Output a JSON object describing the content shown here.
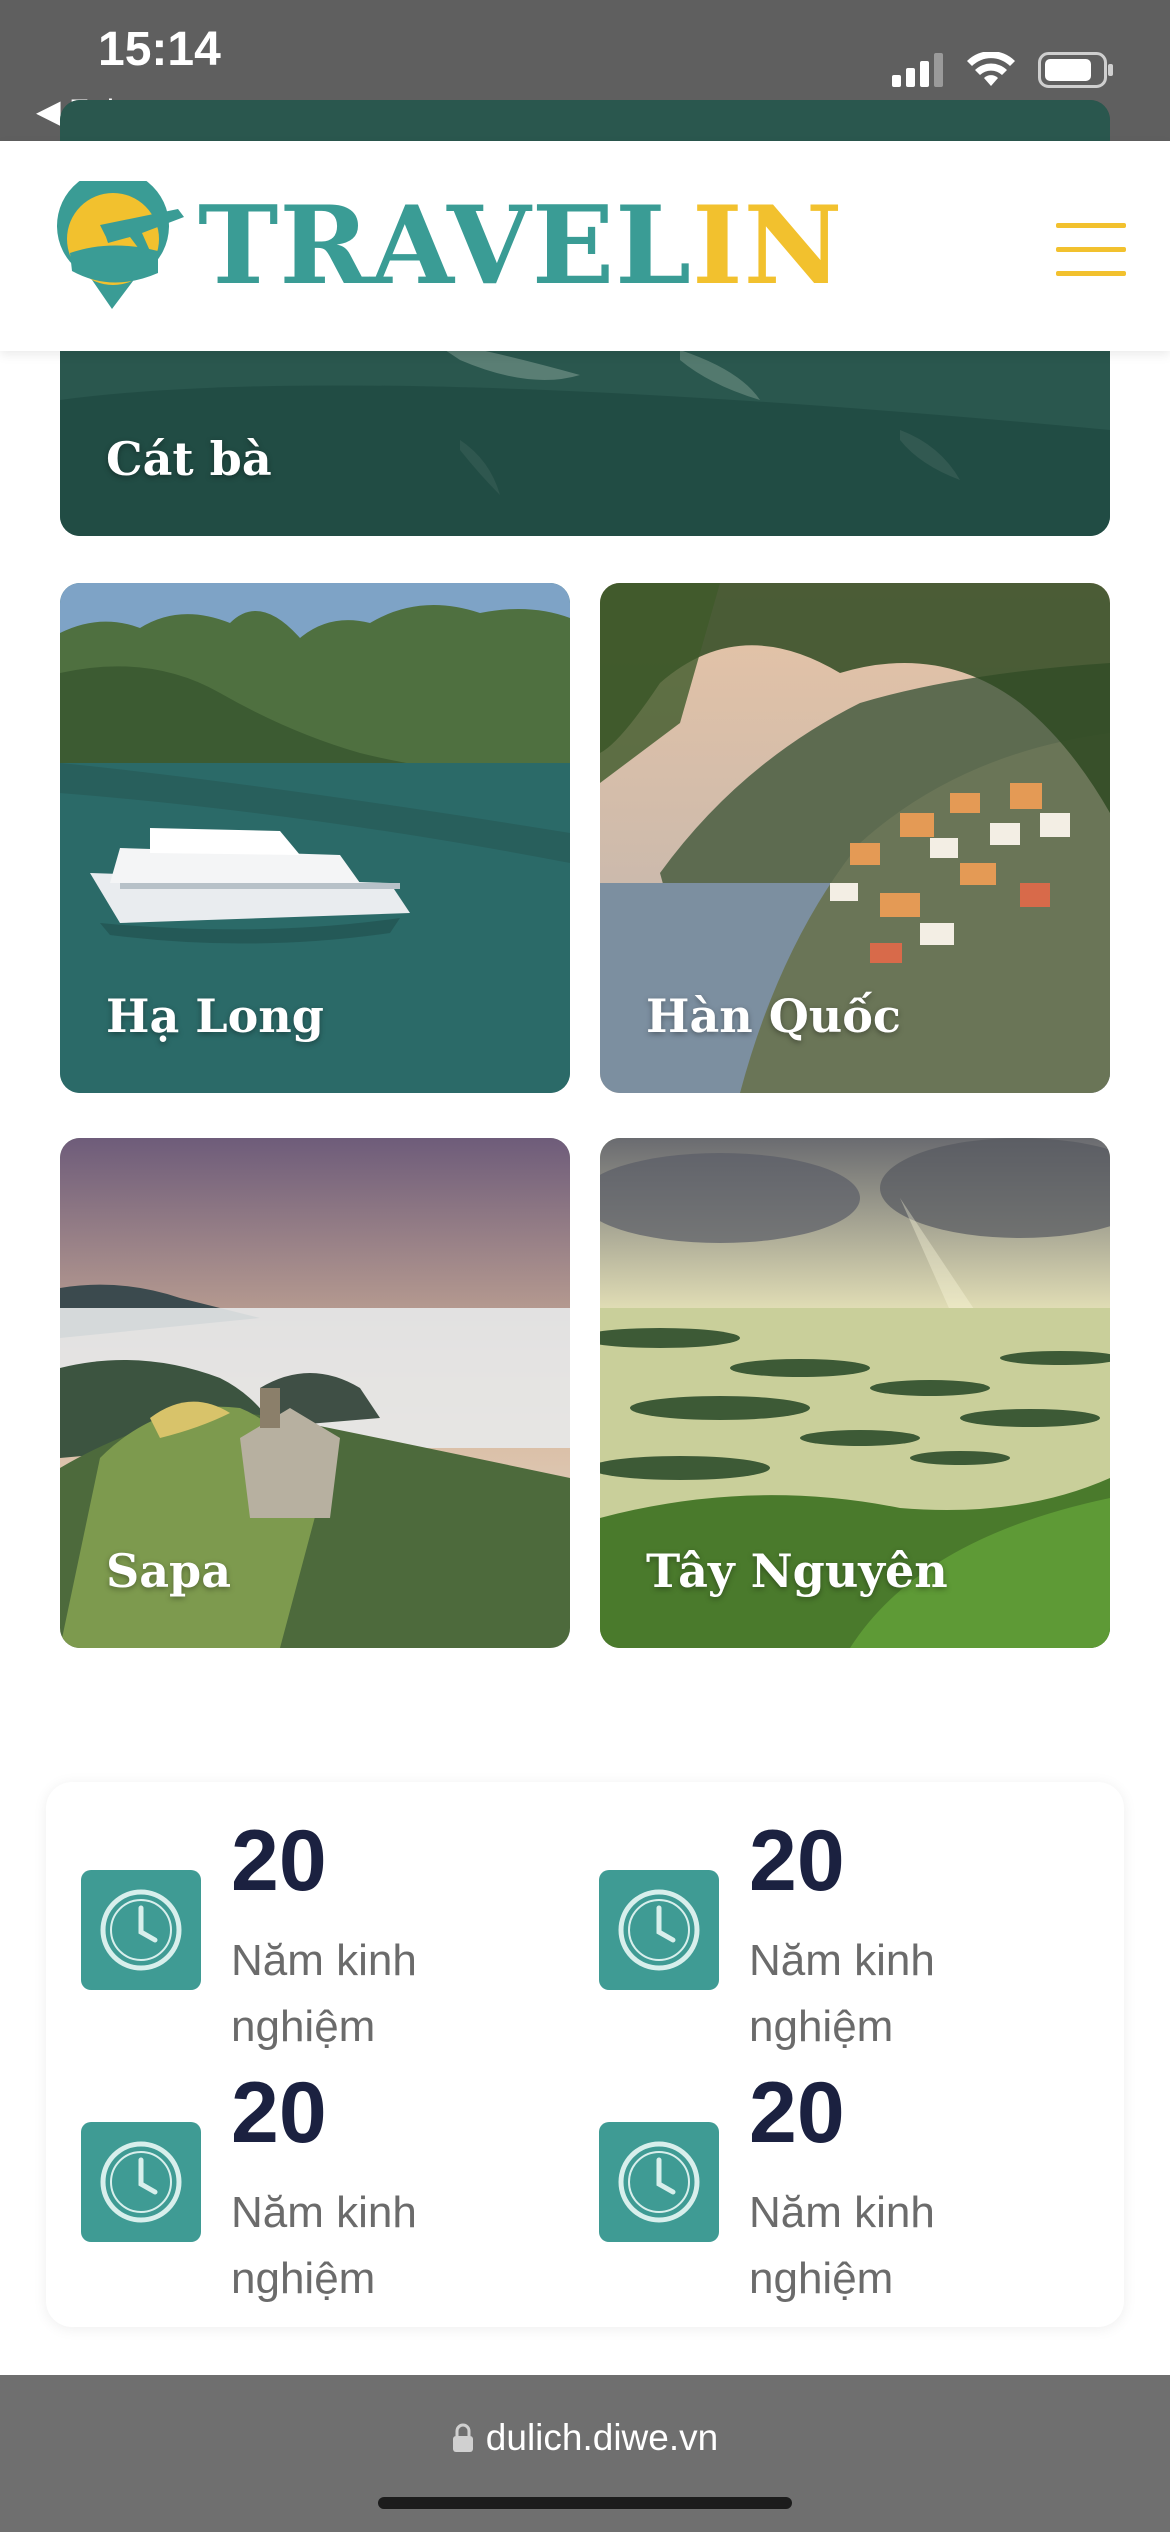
{
  "status_bar": {
    "time": "15:14",
    "back_app": "◀ Zalo",
    "icons": [
      "cellular-signal-icon",
      "wifi-icon",
      "battery-icon"
    ]
  },
  "header": {
    "logo_part1": "TRAVEL",
    "logo_part2": "IN",
    "menu_icon": "hamburger-menu-icon"
  },
  "destinations": [
    {
      "label": "Cát bà"
    },
    {
      "label": "Hạ Long"
    },
    {
      "label": "Hàn Quốc"
    },
    {
      "label": "Sapa"
    },
    {
      "label": "Tây Nguyên"
    }
  ],
  "stats": [
    {
      "value": "20",
      "label": "Năm kinh nghiệm",
      "icon": "clock-icon"
    },
    {
      "value": "20",
      "label": "Năm kinh nghiệm",
      "icon": "clock-icon"
    },
    {
      "value": "20",
      "label": "Năm kinh nghiệm",
      "icon": "clock-icon"
    },
    {
      "value": "20",
      "label": "Năm kinh nghiệm",
      "icon": "clock-icon"
    }
  ],
  "url_bar": {
    "url": "dulich.diwe.vn",
    "lock_icon": "lock-icon"
  },
  "colors": {
    "brand_teal": "#3a9c95",
    "brand_yellow": "#f2c12e",
    "stat_number": "#1b2140"
  }
}
